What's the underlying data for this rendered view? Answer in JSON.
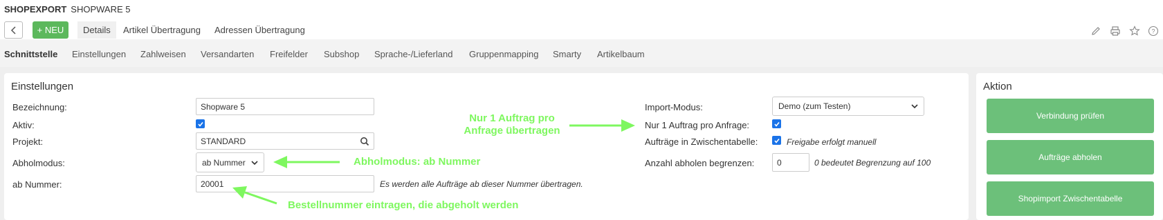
{
  "header": {
    "app_name": "SHOPEXPORT",
    "module_name": "SHOPWARE 5"
  },
  "toolbar": {
    "new_label": "+ NEU",
    "tabs": [
      {
        "label": "Details"
      },
      {
        "label": "Artikel Übertragung"
      },
      {
        "label": "Adressen Übertragung"
      }
    ]
  },
  "subnav": {
    "items": [
      {
        "label": "Schnittstelle"
      },
      {
        "label": "Einstellungen"
      },
      {
        "label": "Zahlweisen"
      },
      {
        "label": "Versandarten"
      },
      {
        "label": "Freifelder"
      },
      {
        "label": "Subshop"
      },
      {
        "label": "Sprache-/Lieferland"
      },
      {
        "label": "Gruppenmapping"
      },
      {
        "label": "Smarty"
      },
      {
        "label": "Artikelbaum"
      }
    ]
  },
  "settings": {
    "title": "Einstellungen",
    "bezeichnung_label": "Bezeichnung:",
    "bezeichnung_value": "Shopware 5",
    "aktiv_label": "Aktiv:",
    "projekt_label": "Projekt:",
    "projekt_value": "STANDARD",
    "abholmodus_label": "Abholmodus:",
    "abholmodus_value": "ab Nummer",
    "abnummer_label": "ab Nummer:",
    "abnummer_value": "20001",
    "abnummer_hint": "Es werden alle Aufträge ab dieser Nummer übertragen.",
    "importmodus_label": "Import-Modus:",
    "importmodus_value": "Demo (zum Testen)",
    "nur1_label": "Nur 1 Auftrag pro Anfrage:",
    "zwischentabelle_label": "Aufträge in Zwischentabelle:",
    "zwischentabelle_hint": "Freigabe erfolgt manuell",
    "anzahl_label": "Anzahl abholen begrenzen:",
    "anzahl_value": "0",
    "anzahl_hint": "0 bedeutet Begrenzung auf 100"
  },
  "annotations": {
    "nur1_line1": "Nur 1 Auftrag pro",
    "nur1_line2": "Anfrage übertragen",
    "abholmodus": "Abholmodus: ab Nummer",
    "bestellnummer": "Bestellnummer eintragen, die abgeholt werden",
    "color": "#7ef75f"
  },
  "action": {
    "title": "Aktion",
    "buttons": [
      {
        "label": "Verbindung prüfen"
      },
      {
        "label": "Aufträge abholen"
      },
      {
        "label": "Shopimport Zwischentabelle"
      }
    ]
  },
  "colors": {
    "accent_green": "#5cb85c",
    "action_green": "#6cc07a",
    "checkbox_blue": "#1a73e8"
  }
}
